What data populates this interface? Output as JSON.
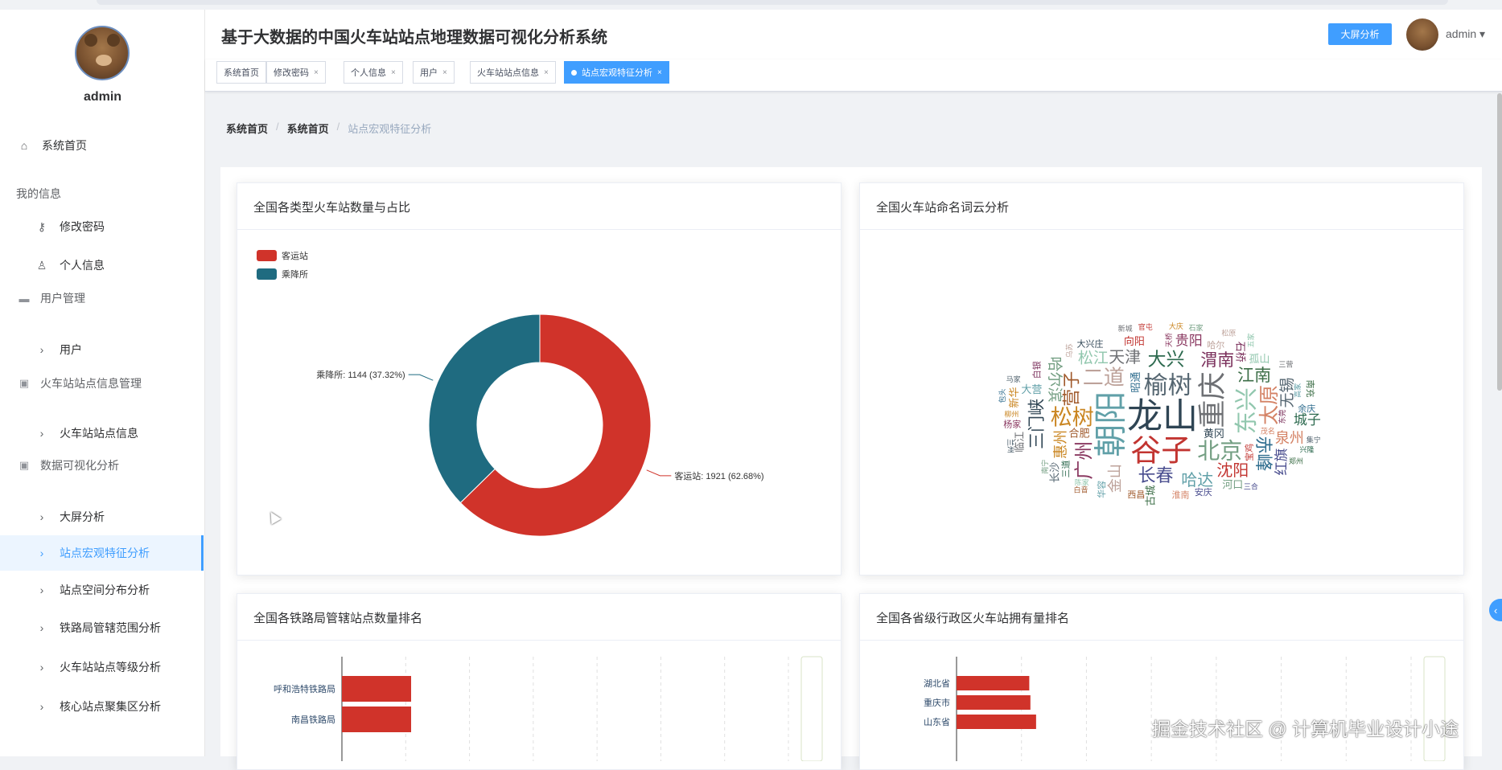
{
  "app": {
    "title": "基于大数据的中国火车站站点地理数据可视化分析系统",
    "big_screen_button": "大屏分析",
    "user": "admin",
    "user_caret": "▾"
  },
  "sidebar": {
    "username": "admin",
    "items": [
      {
        "type": "item",
        "label": "系统首页",
        "icon": "home-icon"
      },
      {
        "type": "group",
        "label": "我的信息"
      },
      {
        "type": "sub",
        "label": "修改密码",
        "icon": "key-icon"
      },
      {
        "type": "sub",
        "label": "个人信息",
        "icon": "person-icon"
      },
      {
        "type": "group",
        "label": "用户管理",
        "icon": "briefcase-icon"
      },
      {
        "type": "sub",
        "label": "用户",
        "icon": "chevron-right-icon"
      },
      {
        "type": "group",
        "label": "火车站站点信息管理",
        "icon": "clipboard-icon"
      },
      {
        "type": "sub",
        "label": "火车站站点信息",
        "icon": "chevron-right-icon"
      },
      {
        "type": "group",
        "label": "数据可视化分析",
        "icon": "clipboard-icon"
      },
      {
        "type": "sub",
        "label": "大屏分析",
        "icon": "chevron-right-icon"
      },
      {
        "type": "sub",
        "label": "站点宏观特征分析",
        "icon": "chevron-right-icon",
        "active": true
      },
      {
        "type": "sub",
        "label": "站点空间分布分析",
        "icon": "chevron-right-icon"
      },
      {
        "type": "sub",
        "label": "铁路局管辖范围分析",
        "icon": "chevron-right-icon"
      },
      {
        "type": "sub",
        "label": "火车站站点等级分析",
        "icon": "chevron-right-icon"
      },
      {
        "type": "sub",
        "label": "核心站点聚集区分析",
        "icon": "chevron-right-icon"
      }
    ]
  },
  "tags": [
    {
      "label": "系统首页",
      "closable": false
    },
    {
      "label": "修改密码",
      "closable": true
    },
    {
      "label": "个人信息",
      "closable": true
    },
    {
      "label": "用户",
      "closable": true
    },
    {
      "label": "火车站站点信息",
      "closable": true
    },
    {
      "label": "站点宏观特征分析",
      "closable": true,
      "active": true
    }
  ],
  "breadcrumb": [
    "系统首页",
    "系统首页",
    "站点宏观特征分析"
  ],
  "cards": {
    "pie_title": "全国各类型火车站数量与占比",
    "wordcloud_title": "全国火车站命名词云分析",
    "bureau_title": "全国各铁路局管辖站点数量排名",
    "province_title": "全国各省级行政区火车站拥有量排名"
  },
  "chart_data": [
    {
      "type": "pie",
      "title": "全国各类型火车站数量与占比",
      "legend_position": "top-left",
      "slices": [
        {
          "name": "客运站",
          "value": 1921,
          "percent": 62.68,
          "label": "客运站: 1921 (62.68%)",
          "color": "#d0332a"
        },
        {
          "name": "乘降所",
          "value": 1144,
          "percent": 37.32,
          "label": "乘降所: 1144 (37.32%)",
          "color": "#1f6b80"
        }
      ]
    },
    {
      "type": "bar",
      "title": "全国各铁路局管辖站点数量排名",
      "orientation": "horizontal",
      "categories": [
        "呼和浩特铁路局",
        "南昌铁路局"
      ],
      "values": [
        0.62,
        0.62
      ],
      "color": "#d0332a"
    },
    {
      "type": "bar",
      "title": "全国各省级行政区火车站拥有量排名",
      "orientation": "horizontal",
      "categories": [
        "湖北省",
        "重庆市",
        "山东省"
      ],
      "values": [
        0.64,
        0.65,
        0.7
      ],
      "color": "#d0332a"
    }
  ],
  "wordcloud": {
    "words": [
      "龙山",
      "朝阳",
      "谷子",
      "重庆",
      "榆树",
      "东兴",
      "北京",
      "松树",
      "二道",
      "太原",
      "广州",
      "大兴",
      "长春",
      "营子",
      "赤峰",
      "渭南",
      "江南",
      "三门峡",
      "哈达",
      "沈阳",
      "天津",
      "无锡",
      "松江",
      "哈尔滨",
      "惠州",
      "金山",
      "泉州",
      "贵阳",
      "城子",
      "红旗",
      "合肥",
      "昭通",
      "石桥",
      "古城",
      "黄冈",
      "大营",
      "向阳",
      "临江",
      "长沙",
      "孤山",
      "河口",
      "新华",
      "哈尔",
      "淮南",
      "杨家",
      "三道",
      "安庆",
      "西昌",
      "余庆",
      "白银",
      "南充",
      "大兴庄",
      "华容",
      "宝鸡",
      "三营",
      "集宁",
      "陈家",
      "南宁",
      "柳州",
      "乌苏",
      "茂名",
      "天桥",
      "兴隆",
      "三合",
      "白音",
      "包头",
      "东莞",
      "郑州",
      "兰州",
      "高家",
      "官屯",
      "新城",
      "马家",
      "五家",
      "石家",
      "大庆",
      "松原"
    ]
  },
  "watermark": "掘金技术社区 @ 计算机毕业设计小途"
}
